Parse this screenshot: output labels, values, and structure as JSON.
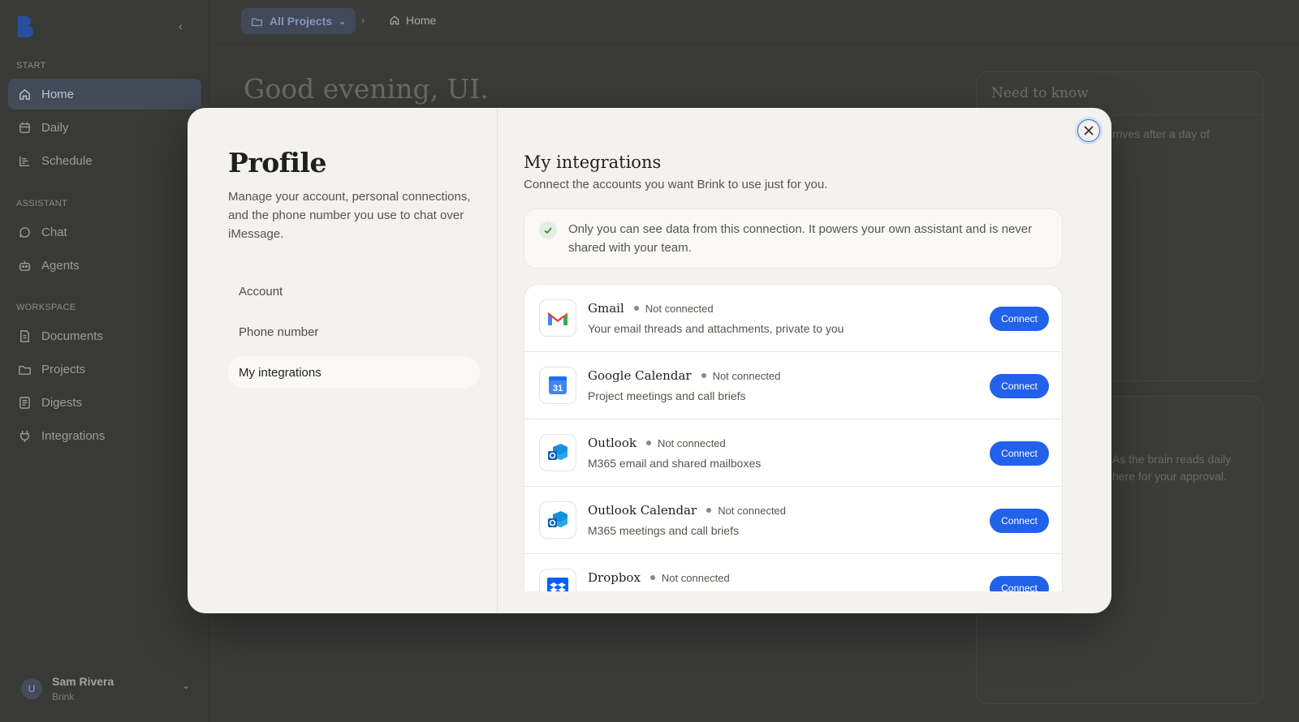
{
  "sidebar": {
    "sections": [
      "START",
      "ASSISTANT",
      "WORKSPACE"
    ],
    "items": [
      {
        "label": "Home",
        "icon": "home-icon",
        "active": true
      },
      {
        "label": "Daily",
        "icon": "calendar-icon"
      },
      {
        "label": "Schedule",
        "icon": "schedule-icon"
      },
      {
        "label": "Chat",
        "icon": "chat-icon"
      },
      {
        "label": "Agents",
        "icon": "robot-icon"
      },
      {
        "label": "Documents",
        "icon": "document-icon"
      },
      {
        "label": "Projects",
        "icon": "folder-icon"
      },
      {
        "label": "Digests",
        "icon": "digest-icon"
      },
      {
        "label": "Integrations",
        "icon": "plug-icon"
      }
    ],
    "user": {
      "initial": "U",
      "name": "Sam Rivera",
      "org": "Brink"
    }
  },
  "topbar": {
    "project": "All Projects",
    "current": "Home"
  },
  "main": {
    "greeting": "Good evening, UI.",
    "card1_title": "Need to know",
    "card1_text": "rrives after a day of",
    "card2_text": "As the brain reads daily\nhere for your approval."
  },
  "modal": {
    "title": "Profile",
    "description": "Manage your account, personal connections, and the phone number you use to chat over iMessage.",
    "tabs": [
      {
        "label": "Account"
      },
      {
        "label": "Phone number"
      },
      {
        "label": "My integrations",
        "active": true
      }
    ],
    "section_title": "My integrations",
    "section_subtitle": "Connect the accounts you want Brink to use just for you.",
    "notice": "Only you can see data from this connection. It powers your own assistant and is never shared with your team.",
    "connect_label": "Connect",
    "integrations": [
      {
        "name": "Gmail",
        "status": "Not connected",
        "description": "Your email threads and attachments, private to you",
        "icon": "gmail-icon"
      },
      {
        "name": "Google Calendar",
        "status": "Not connected",
        "description": "Project meetings and call briefs",
        "icon": "google-calendar-icon",
        "icon_text": "31"
      },
      {
        "name": "Outlook",
        "status": "Not connected",
        "description": "M365 email and shared mailboxes",
        "icon": "outlook-icon"
      },
      {
        "name": "Outlook Calendar",
        "status": "Not connected",
        "description": "M365 meetings and call briefs",
        "icon": "outlook-icon"
      },
      {
        "name": "Dropbox",
        "status": "Not connected",
        "description": "",
        "icon": "dropbox-icon"
      }
    ]
  }
}
